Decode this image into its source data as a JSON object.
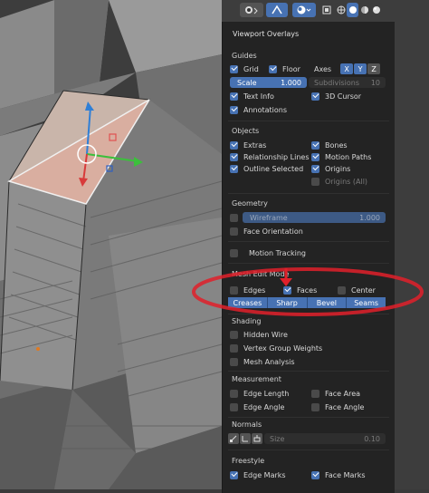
{
  "panel": {
    "title": "Viewport Overlays",
    "guides": {
      "heading": "Guides",
      "grid": "Grid",
      "floor": "Floor",
      "axes": "Axes",
      "axis_x": "X",
      "axis_y": "Y",
      "axis_z": "Z",
      "scale_label": "Scale",
      "scale_value": "1.000",
      "subdivisions_label": "Subdivisions",
      "subdivisions_value": "10",
      "text_info": "Text Info",
      "cursor_3d": "3D Cursor",
      "annotations": "Annotations"
    },
    "objects": {
      "heading": "Objects",
      "extras": "Extras",
      "bones": "Bones",
      "relationship_lines": "Relationship Lines",
      "motion_paths": "Motion Paths",
      "outline_selected": "Outline Selected",
      "origins": "Origins",
      "origins_all": "Origins (All)"
    },
    "geometry": {
      "heading": "Geometry",
      "wireframe_label": "Wireframe",
      "wireframe_value": "1.000",
      "face_orientation": "Face Orientation",
      "motion_tracking": "Motion Tracking"
    },
    "mesh_edit": {
      "heading": "Mesh Edit Mode",
      "edges": "Edges",
      "faces": "Faces",
      "center": "Center",
      "creases": "Creases",
      "sharp": "Sharp",
      "bevel": "Bevel",
      "seams": "Seams"
    },
    "shading": {
      "heading": "Shading",
      "hidden_wire": "Hidden Wire",
      "vertex_group_weights": "Vertex Group Weights",
      "mesh_analysis": "Mesh Analysis"
    },
    "measurement": {
      "heading": "Measurement",
      "edge_length": "Edge Length",
      "face_area": "Face Area",
      "edge_angle": "Edge Angle",
      "face_angle": "Face Angle"
    },
    "normals": {
      "heading": "Normals",
      "size_label": "Size",
      "size_value": "0.10"
    },
    "freestyle": {
      "heading": "Freestyle",
      "edge_marks": "Edge Marks",
      "face_marks": "Face Marks"
    }
  },
  "colors": {
    "accent": "#4772b3",
    "panel_bg": "#232323",
    "annotation_red": "#e0202a"
  },
  "icons": [
    "gizmo-icon",
    "navigate-icon",
    "overlays-icon",
    "xray-icon",
    "wireframe-shading-icon",
    "solid-shading-icon",
    "material-shading-icon",
    "rendered-shading-icon"
  ]
}
